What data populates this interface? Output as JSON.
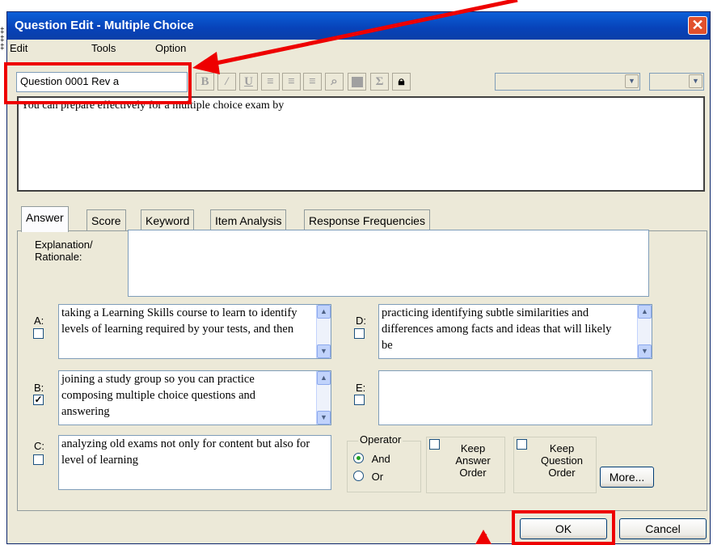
{
  "window": {
    "title": "Question Edit - Multiple Choice"
  },
  "menu": [
    "Edit",
    "Tools",
    "Option"
  ],
  "toolbar": {
    "question_id": "Question 0001 Rev a"
  },
  "question": {
    "text": "You can prepare effectively for a multiple choice exam by"
  },
  "tabs": [
    "Answer",
    "Score",
    "Keyword",
    "Item Analysis",
    "Response Frequencies"
  ],
  "explanation": {
    "label": "Explanation/\nRationale:",
    "value": ""
  },
  "answers": [
    {
      "letter": "A:",
      "checked": false,
      "text": "taking a Learning Skills course to learn to identify levels of learning required by your tests, and then"
    },
    {
      "letter": "B:",
      "checked": true,
      "text": "joining a study group so you can practice composing multiple choice questions and answering"
    },
    {
      "letter": "C:",
      "checked": false,
      "text": "analyzing old exams not only for content but also for level of learning"
    },
    {
      "letter": "D:",
      "checked": false,
      "text": "practicing identifying subtle similarities and differences among facts and ideas that will likely be"
    },
    {
      "letter": "E:",
      "checked": false,
      "text": ""
    }
  ],
  "operator": {
    "label": "Operator",
    "options": [
      "And",
      "Or"
    ],
    "selected": "And"
  },
  "keep_answer_order": {
    "label": "Keep\nAnswer\nOrder",
    "checked": false
  },
  "keep_question_order": {
    "label": "Keep\nQuestion\nOrder",
    "checked": false
  },
  "buttons": {
    "more": "More...",
    "ok": "OK",
    "cancel": "Cancel"
  },
  "colors": {
    "highlight": "#ee0000",
    "titlebar": "#0842b8"
  }
}
